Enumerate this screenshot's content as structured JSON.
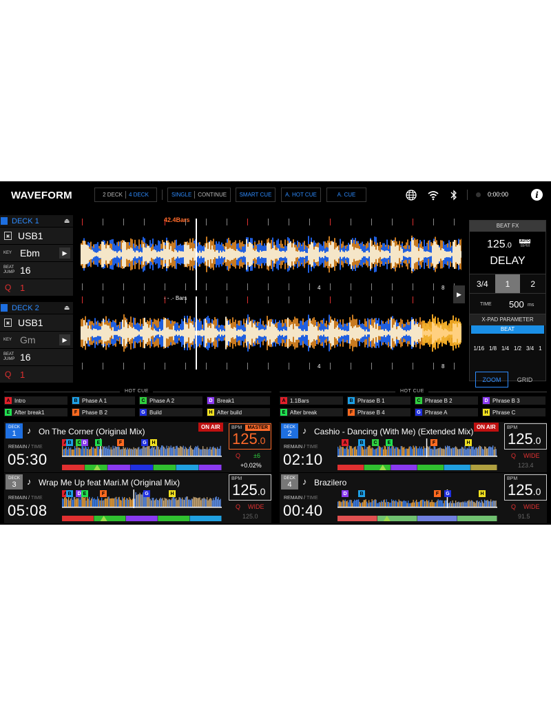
{
  "topbar": {
    "title": "WAVEFORM",
    "deck_mode": [
      "2 DECK",
      "4 DECK"
    ],
    "play_mode": [
      "SINGLE",
      "CONTINUE"
    ],
    "smart_cue": "SMART CUE",
    "hot_cue": "A. HOT CUE",
    "auto_cue": "A. CUE",
    "timer": "0:00:00",
    "info": "i"
  },
  "deck_panels": [
    {
      "label": "DECK 1",
      "source": "USB1",
      "key_label": "KEY",
      "key": "Ebm",
      "beat_jump_label": "BEAT JUMP",
      "beat_jump": "16",
      "q_label": "Q",
      "q_value": "1"
    },
    {
      "label": "DECK 2",
      "source": "USB1",
      "key_label": "KEY",
      "key": "Gm",
      "beat_jump_label": "BEAT JUMP",
      "beat_jump": "16",
      "q_label": "Q",
      "q_value": "1"
    }
  ],
  "waveform": {
    "top_bars": "42.4Bars",
    "bottom_bars": "- - .- Bars",
    "beat_labels": [
      "4",
      "8",
      "4",
      "8"
    ]
  },
  "beat_fx": {
    "header": "BEAT FX",
    "bpm": "125",
    "bpm_decimal": ".0",
    "auto": "AUTO",
    "bpm_label": "BPM",
    "effect": "DELAY",
    "beats": [
      "3/4",
      "1",
      "2"
    ],
    "time_label": "TIME",
    "time_value": "500",
    "time_unit": "ms",
    "xpad_header": "X-PAD PARAMETER",
    "xpad_mode": "BEAT",
    "xpad_values": [
      "1/16",
      "1/8",
      "1/4",
      "1/2",
      "3/4",
      "1"
    ],
    "zoom": "ZOOM",
    "grid": "GRID"
  },
  "hot_cue_left": {
    "title": "HOT CUE",
    "items": [
      {
        "key": "A",
        "label": "Intro",
        "color": "#e0202a"
      },
      {
        "key": "B",
        "label": "Phase A 1",
        "color": "#1ea0e6"
      },
      {
        "key": "C",
        "label": "Phase A 2",
        "color": "#30d040"
      },
      {
        "key": "D",
        "label": "Break1",
        "color": "#8a3af0"
      },
      {
        "key": "E",
        "label": "After break1",
        "color": "#20e050"
      },
      {
        "key": "F",
        "label": "Phase B 2",
        "color": "#ff6a20"
      },
      {
        "key": "G",
        "label": "Build",
        "color": "#2030e0"
      },
      {
        "key": "H",
        "label": "After build",
        "color": "#f0e020"
      }
    ]
  },
  "hot_cue_right": {
    "title": "HOT CUE",
    "items": [
      {
        "key": "A",
        "label": "1.1Bars",
        "color": "#e0202a"
      },
      {
        "key": "B",
        "label": "Phrase B 1",
        "color": "#1ea0e6"
      },
      {
        "key": "C",
        "label": "Phrase B 2",
        "color": "#30d040"
      },
      {
        "key": "D",
        "label": "Phrase B 3",
        "color": "#8a3af0"
      },
      {
        "key": "E",
        "label": "After break",
        "color": "#20e050"
      },
      {
        "key": "F",
        "label": "Phrase B 4",
        "color": "#ff6a20"
      },
      {
        "key": "G",
        "label": "Phrase A",
        "color": "#2030e0"
      },
      {
        "key": "H",
        "label": "Phrase C",
        "color": "#f0e020"
      }
    ]
  },
  "decks": [
    {
      "deck_label": "DECK",
      "number": "1",
      "track": "On The Corner (Original Mix)",
      "on_air": "ON AIR",
      "remain_label": "REMAIN",
      "time_label": "TIME",
      "time": "05:30",
      "bpm_label": "BPM",
      "master": "MASTER",
      "bpm": "125",
      "bpm_decimal": ".0",
      "q": "Q",
      "key_shift": "±6",
      "pitch": "+0.02%",
      "sub_bpm": ""
    },
    {
      "deck_label": "DECK",
      "number": "2",
      "track": "Cashio - Dancing (With Me) (Extended Mix)",
      "on_air": "ON AIR",
      "remain_label": "REMAIN",
      "time_label": "TIME",
      "time": "02:10",
      "bpm_label": "BPM",
      "master": "",
      "bpm": "125",
      "bpm_decimal": ".0",
      "q": "Q",
      "key_shift": "WIDE",
      "pitch": "",
      "sub_bpm": "123.4"
    },
    {
      "deck_label": "DECK",
      "number": "3",
      "track": "Wrap Me Up feat Mari.M (Original Mix)",
      "on_air": "",
      "remain_label": "REMAIN",
      "time_label": "TIME",
      "time": "05:08",
      "bpm_label": "BPM",
      "master": "",
      "bpm": "125",
      "bpm_decimal": ".0",
      "q": "Q",
      "key_shift": "WIDE",
      "pitch": "",
      "sub_bpm": "125.0"
    },
    {
      "deck_label": "DECK",
      "number": "4",
      "track": "Brazilero",
      "on_air": "",
      "remain_label": "REMAIN",
      "time_label": "TIME",
      "time": "00:40",
      "bpm_label": "BPM",
      "master": "",
      "bpm": "125",
      "bpm_decimal": ".0",
      "q": "Q",
      "key_shift": "WIDE",
      "pitch": "",
      "sub_bpm": "91.5"
    }
  ],
  "colors": {
    "accent": "#2e8cff",
    "wave_blue": "#1f5fe0",
    "wave_orange": "#c87a20",
    "wave_cream": "#f5e6c8",
    "on_air": "#c01010",
    "master": "#ff6a2a"
  }
}
